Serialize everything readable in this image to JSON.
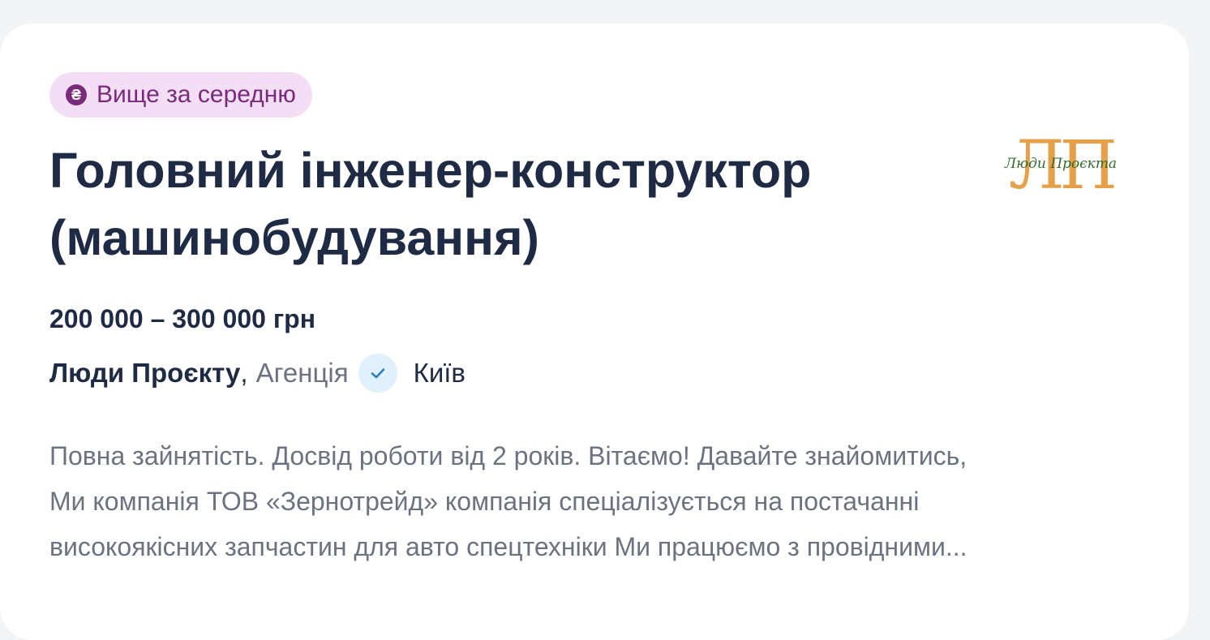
{
  "badge": {
    "icon": "hryvnia-icon",
    "icon_glyph": "₴",
    "label": "Вище за середню",
    "color": "#7a2a7a",
    "background": "#f3def5"
  },
  "job": {
    "title_line1": "Головний інженер-конструктор",
    "title_line2": "(машинобудування)",
    "salary": "200 000 – 300 000 грн"
  },
  "company": {
    "name": "Люди Проєкту",
    "separator": ",",
    "type": "Агенція",
    "verified_icon": "check-icon",
    "city": "Київ",
    "logo": {
      "letters": "ЛП",
      "script_text": "Люди Проєкта"
    }
  },
  "description": {
    "line1": "Повна зайнятість. Досвід роботи від 2 років. Вітаємо! Давайте знайомитись,",
    "line2": "Ми компанія ТОВ «Зернотрейд» компанія спеціалізується на постачанні",
    "line3": "високоякісних запчастин для авто спецтехніки Ми працюємо з провідними..."
  },
  "colors": {
    "title": "#1f2a44",
    "muted": "#6b7280",
    "logo_gold": "#e7a04a",
    "logo_green": "#2f6b2a",
    "verified_bg": "#e0f0fc",
    "verified_check": "#2b7fc4"
  }
}
